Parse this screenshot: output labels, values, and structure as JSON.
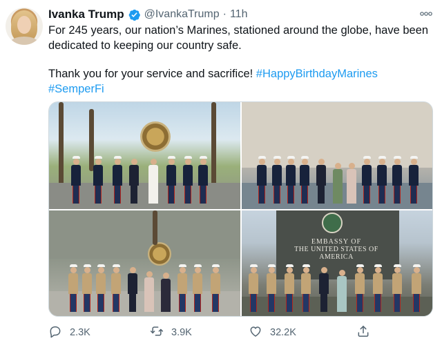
{
  "tweet": {
    "author_name": "Ivanka Trump",
    "handle": "@IvankaTrump",
    "separator": "·",
    "time": "11h",
    "line1": "For 245 years, our nation’s Marines, stationed around the globe, have been dedicated to keeping our country safe.",
    "line2_text": "Thank you for your service and sacrifice! ",
    "hashtag1": "#HappyBirthdayMarines",
    "hashtag2": "#SemperFi"
  },
  "media": {
    "photo4_sign_line1": "EMBASSY OF",
    "photo4_sign_line2": "THE UNITED STATES OF AMERICA"
  },
  "actions": {
    "replies": "2.3K",
    "retweets": "3.9K",
    "likes": "32.2K"
  },
  "icons": {
    "verified": "verified-badge-icon",
    "more": "more-options-icon",
    "reply": "reply-icon",
    "retweet": "retweet-icon",
    "like": "like-icon",
    "share": "share-icon"
  },
  "colors": {
    "link": "#1d9bf0",
    "secondary_text": "#536471",
    "primary_text": "#0f1419",
    "verified": "#1d9bf0"
  }
}
